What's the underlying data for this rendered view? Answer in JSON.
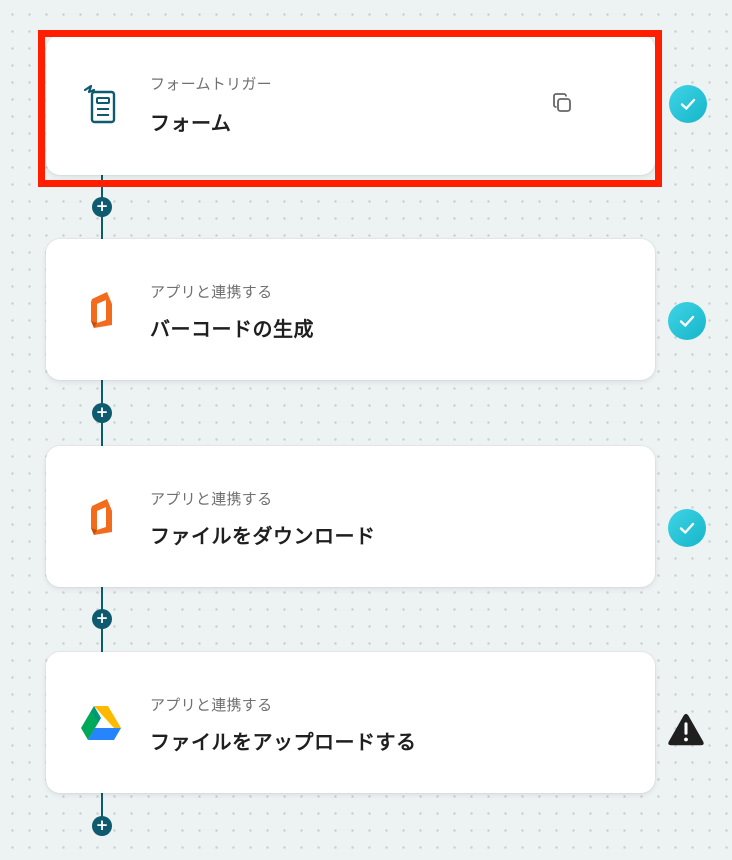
{
  "workflow": {
    "steps": [
      {
        "kind_label": "フォームトリガー",
        "title": "フォーム",
        "icon": "form-icon",
        "status": "complete",
        "selected": true
      },
      {
        "kind_label": "アプリと連携する",
        "title": "バーコードの生成",
        "icon": "document-app-icon",
        "status": "complete",
        "selected": false
      },
      {
        "kind_label": "アプリと連携する",
        "title": "ファイルをダウンロード",
        "icon": "document-app-icon",
        "status": "complete",
        "selected": false
      },
      {
        "kind_label": "アプリと連携する",
        "title": "ファイルをアップロードする",
        "icon": "google-drive-icon",
        "status": "warning",
        "selected": false
      }
    ],
    "add_step_symbol": "+"
  },
  "colors": {
    "connector": "#0e5a6e",
    "highlight": "#ff1f00",
    "check_badge": "#1fc2d6",
    "warning_badge": "#1f1f1f",
    "doc_app_orange": "#f36b1c",
    "form_icon_teal": "#0e5a6e"
  }
}
